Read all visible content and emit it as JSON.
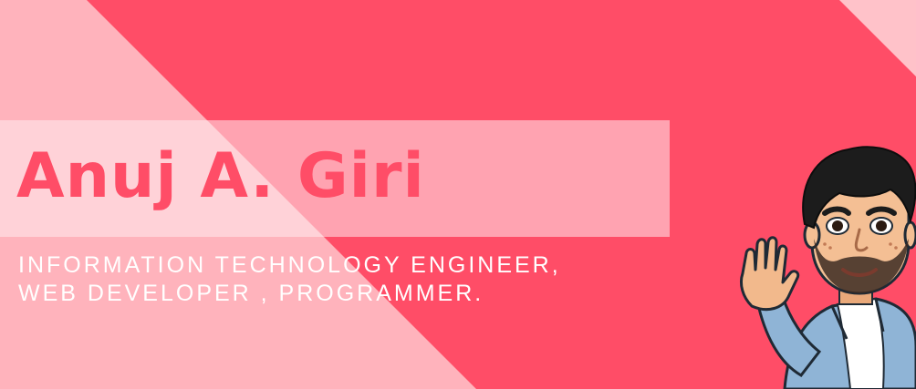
{
  "banner": {
    "name": "Anuj A. Giri",
    "subtitle_line1": "INFORMATION TECHNOLOGY ENGINEER,",
    "subtitle_line2": "WEB DEVELOPER , PROGRAMMER."
  },
  "colors": {
    "primary": "#ff4d67",
    "light_pink": "#ffb3bc",
    "band": "#ffe4e8",
    "text_light": "#ffffff"
  },
  "icons": {
    "avatar": "waving-cartoon-avatar"
  }
}
